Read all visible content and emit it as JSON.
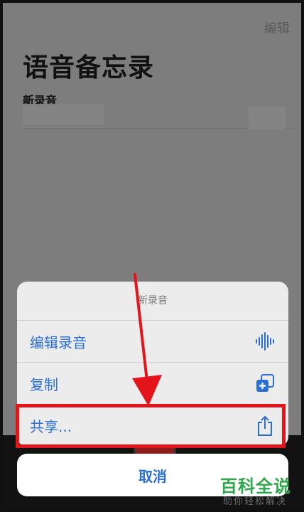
{
  "app": {
    "edit_label": "编辑",
    "title": "语音备忘录",
    "recording": {
      "name": "新录音"
    }
  },
  "action_sheet": {
    "title": "新录音",
    "items": [
      {
        "label": "编辑录音",
        "icon": "waveform-icon"
      },
      {
        "label": "复制",
        "icon": "duplicate-icon"
      },
      {
        "label": "共享...",
        "icon": "share-icon"
      }
    ],
    "cancel_label": "取消"
  },
  "annotation": {
    "highlight_color": "#e4141b",
    "target": "共享..."
  },
  "watermark": {
    "main": "百科全说",
    "sub": "助你轻松解决"
  },
  "colors": {
    "accent": "#2a6fd6",
    "overlay": "#7d7d7d",
    "watermark": "#2fa84a"
  }
}
